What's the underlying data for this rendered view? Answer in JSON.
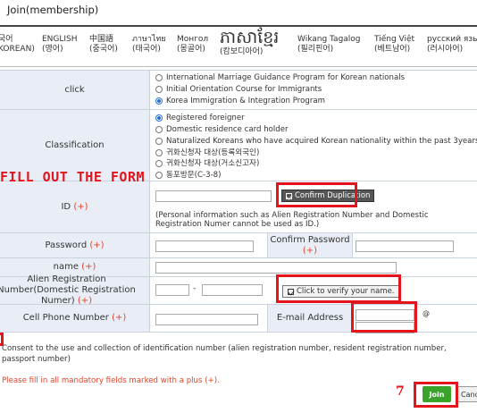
{
  "page": {
    "title": "Join(membership)"
  },
  "languages": [
    {
      "line1": "국어",
      "line2": "KOREAN)"
    },
    {
      "line1": "ENGLISH",
      "line2": "(영어)"
    },
    {
      "line1": "中国語",
      "line2": "(중국어)"
    },
    {
      "line1": "ภาษาไทย",
      "line2": "(태국어)"
    },
    {
      "line1": "Монгол",
      "line2": "(몽골어)"
    },
    {
      "line1": "ភាសាខ្មែរ",
      "line2": "(캄보디아어)"
    },
    {
      "line1": "Wikang Tagalog",
      "line2": "(필리핀어)"
    },
    {
      "line1": "Tiếng Việt",
      "line2": "(베트남어)"
    },
    {
      "line1": "русский язы",
      "line2": "(러시아어)"
    }
  ],
  "form": {
    "click": {
      "label": "click",
      "options": [
        "International Marriage Guidance Program for Korean nationals",
        "Initial Orientation Course for Immigrants",
        "Korea Immigration & Integration Program"
      ],
      "selected_index": 2
    },
    "classification": {
      "label": "Classification",
      "options": [
        "Registered foreigner",
        "Domestic residence card holder",
        "Naturalized Koreans who have acquired Korean nationality within the past 3years",
        "귀화신청자 대상(등록외국인)",
        "귀화신청자 대상(거소신고자)",
        "동포방문(C-3-8)"
      ],
      "selected_index": 0
    },
    "id": {
      "label": "ID",
      "required_mark": "(+)",
      "confirm_button": "Confirm Duplication",
      "note": "(Personal information such as Alien Registration Number and Domestic Registration Numer cannot be used as ID.)"
    },
    "password": {
      "label": "Password",
      "required_mark": "(+)",
      "confirm_label": "Confirm Password",
      "confirm_required_mark": "(+)"
    },
    "name": {
      "label": "name",
      "required_mark": "(+)"
    },
    "alien_reg": {
      "label": "Alien Registration Number(Domestic Registration Numer)",
      "required_mark": "(+)",
      "separator": "-",
      "verify_button": "Click to verify your name."
    },
    "cell_phone": {
      "label": "Cell Phone Number",
      "required_mark": "(+)",
      "email_label": "E-mail Address",
      "at_sign": "@"
    }
  },
  "overlay": {
    "instruction": "FILL OUT THE FORM",
    "step_number": "7"
  },
  "footer": {
    "consent": "Consent to the use and collection of identification number (alien registration number, resident registration number, passport number)",
    "mandatory_note": "Please fill in all mandatory fields marked with a plus (+).",
    "join_button": "Join",
    "cancel_button": "Cancel"
  },
  "colors": {
    "label_bg": "#e9eef6",
    "required": "#e0452b",
    "annotation": "#e3141b",
    "join_green": "#3aa42a"
  }
}
